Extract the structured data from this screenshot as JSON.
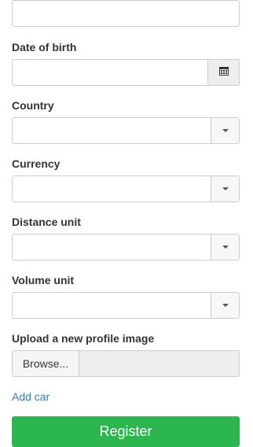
{
  "fields": {
    "top_input_value": "",
    "date_of_birth": {
      "label": "Date of birth",
      "value": ""
    },
    "country": {
      "label": "Country",
      "value": ""
    },
    "currency": {
      "label": "Currency",
      "value": ""
    },
    "distance_unit": {
      "label": "Distance unit",
      "value": ""
    },
    "volume_unit": {
      "label": "Volume unit",
      "value": ""
    },
    "profile_image": {
      "label": "Upload a new profile image",
      "browse_label": "Browse...",
      "file_name": ""
    }
  },
  "links": {
    "add_car": "Add car"
  },
  "actions": {
    "register": "Register"
  },
  "colors": {
    "accent": "#2bb74d",
    "link": "#337ab7"
  },
  "icons": {
    "date_picker": "calendar-icon",
    "select": "chevron-down-icon"
  }
}
